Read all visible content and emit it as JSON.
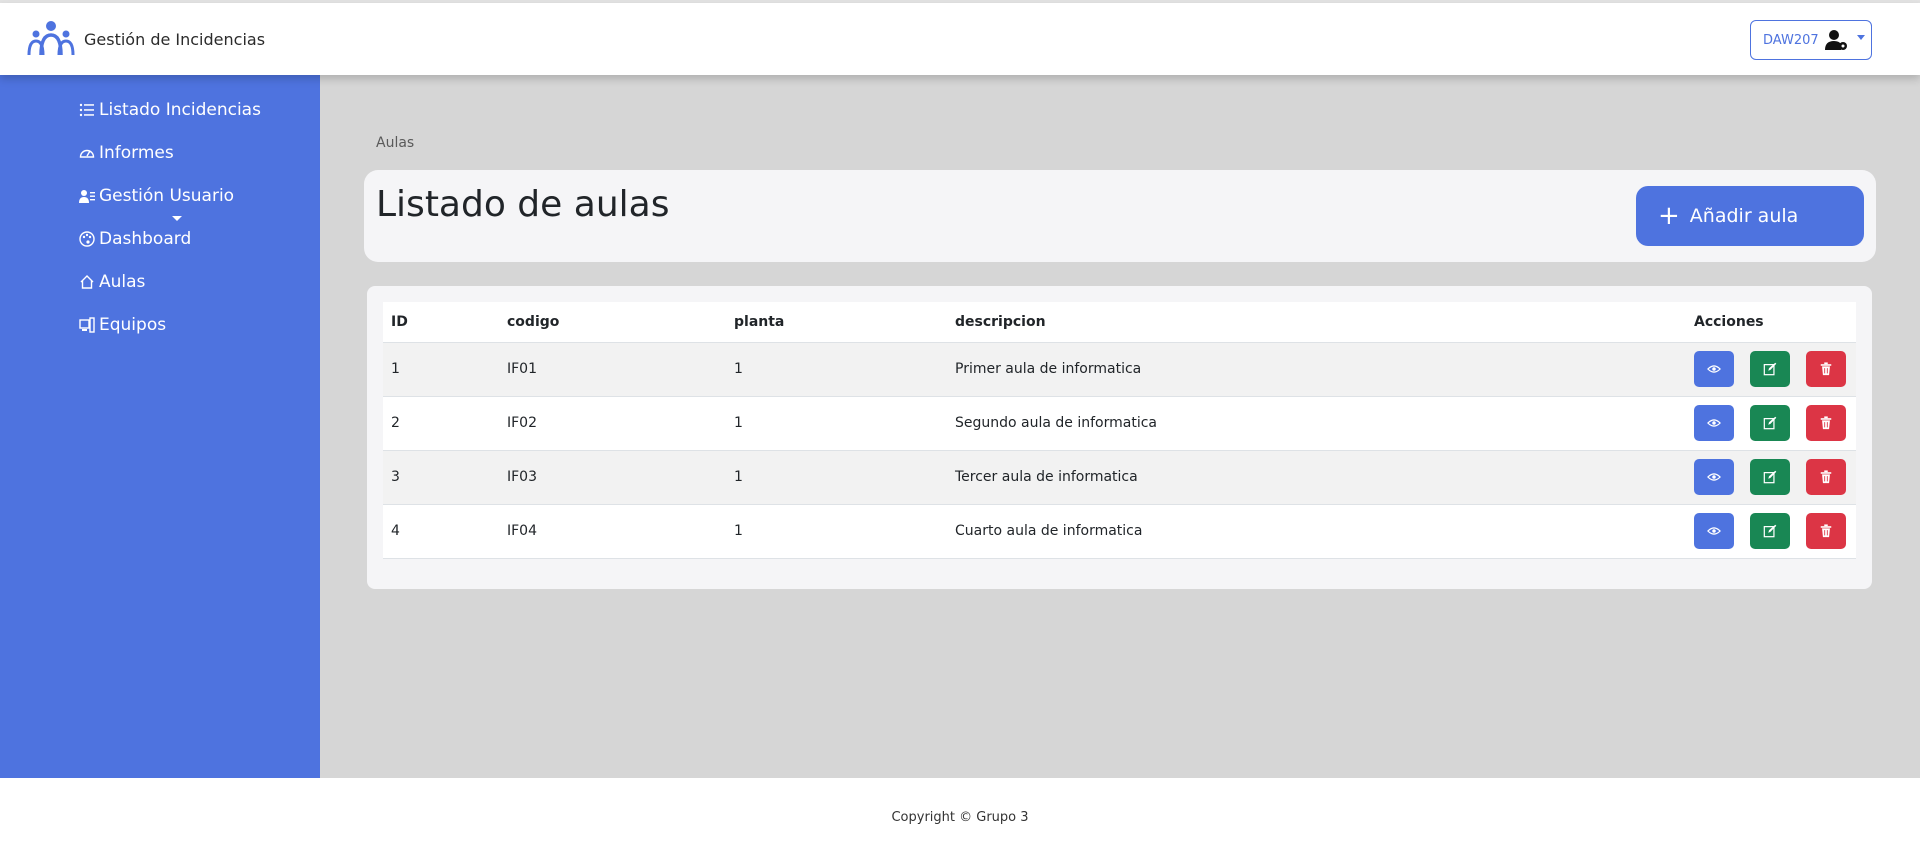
{
  "header": {
    "app_title": "Gestión de Incidencias",
    "user_label": "DAW207",
    "logo_icon": "people-group-icon",
    "user_icon": "user-gear-icon"
  },
  "sidebar": {
    "items": [
      {
        "label": "Listado Incidencias",
        "icon": "list-icon"
      },
      {
        "label": "Informes",
        "icon": "gauge-icon"
      },
      {
        "label": "Gestión Usuario",
        "icon": "user-list-icon"
      },
      {
        "label": "Dashboard",
        "icon": "palette-icon"
      },
      {
        "label": "Aulas",
        "icon": "house-icon"
      },
      {
        "label": "Equipos",
        "icon": "computer-icon"
      }
    ]
  },
  "main": {
    "breadcrumb": "Aulas",
    "page_title": "Listado de aulas",
    "add_button_label": "Añadir aula",
    "table": {
      "headers": [
        "ID",
        "codigo",
        "planta",
        "descripcion",
        "Acciones"
      ],
      "rows": [
        {
          "id": "1",
          "codigo": "IF01",
          "planta": "1",
          "descripcion": "Primer aula de informatica"
        },
        {
          "id": "2",
          "codigo": "IF02",
          "planta": "1",
          "descripcion": "Segundo aula de informatica"
        },
        {
          "id": "3",
          "codigo": "IF03",
          "planta": "1",
          "descripcion": "Tercer aula de informatica"
        },
        {
          "id": "4",
          "codigo": "IF04",
          "planta": "1",
          "descripcion": "Cuarto aula de informatica"
        }
      ]
    }
  },
  "footer": {
    "copyright": "Copyright © Grupo 3"
  },
  "colors": {
    "primary": "#4e73df",
    "success": "#198754",
    "danger": "#dc3545",
    "main_bg": "#d6d6d6"
  }
}
